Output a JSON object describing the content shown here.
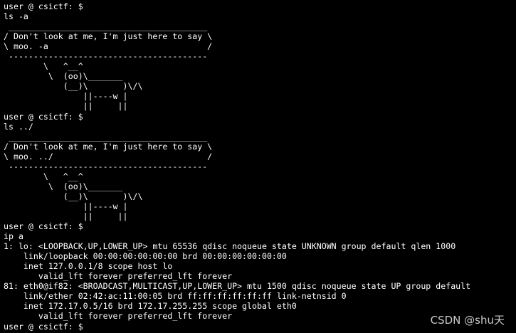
{
  "terminal": {
    "lines": [
      "user @ csictf: $",
      "ls -a",
      " ________________________________________",
      "/ Don't look at me, I'm just here to say \\",
      "\\ moo. -a                                /",
      " ----------------------------------------",
      "        \\   ^__^",
      "         \\  (oo)\\_______",
      "            (__)\\       )\\/\\",
      "                ||----w |",
      "                ||     ||",
      "user @ csictf: $",
      "ls ../",
      " ________________________________________",
      "/ Don't look at me, I'm just here to say \\",
      "\\ moo. ../                               /",
      " ----------------------------------------",
      "        \\   ^__^",
      "         \\  (oo)\\_______",
      "            (__)\\       )\\/\\",
      "                ||----w |",
      "                ||     ||",
      "user @ csictf: $",
      "ip a",
      "1: lo: <LOOPBACK,UP,LOWER_UP> mtu 65536 qdisc noqueue state UNKNOWN group default qlen 1000",
      "    link/loopback 00:00:00:00:00:00 brd 00:00:00:00:00:00",
      "    inet 127.0.0.1/8 scope host lo",
      "       valid_lft forever preferred_lft forever",
      "81: eth0@if82: <BROADCAST,MULTICAST,UP,LOWER_UP> mtu 1500 qdisc noqueue state UP group default",
      "    link/ether 02:42:ac:11:00:05 brd ff:ff:ff:ff:ff:ff link-netnsid 0",
      "    inet 172.17.0.5/16 brd 172.17.255.255 scope global eth0",
      "       valid_lft forever preferred_lft forever",
      "user @ csictf: $"
    ]
  },
  "watermark": "CSDN @shu天",
  "colors": {
    "background": "#000000",
    "foreground": "#ffffff",
    "watermark": "#c9c9c9"
  }
}
